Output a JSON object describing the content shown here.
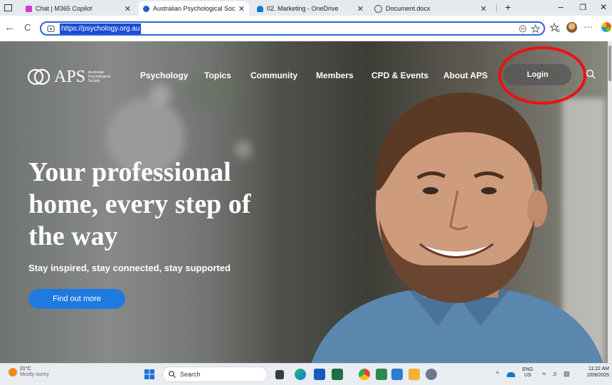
{
  "browser": {
    "tabs": [
      {
        "label": "Chat | M365 Copilot",
        "fav_color": "#c83cc8",
        "active": false
      },
      {
        "label": "Australian Psychological Society |",
        "fav_color": "#2060c0",
        "active": true
      },
      {
        "label": "02. Marketing - OneDrive",
        "fav_color": "#1078d4",
        "active": false
      },
      {
        "label": "Document.docx",
        "fav_color": "#555555",
        "active": false
      }
    ],
    "new_tab_label": "+",
    "minimize_label": "–",
    "restore_label": "❐",
    "close_label": "✕",
    "url": "https://psychology.org.au",
    "back_label": "←",
    "refresh_label": "C",
    "more_label": "···"
  },
  "site": {
    "logo_abbr": "APS",
    "logo_full": "Australian Psychological Society",
    "nav": [
      "Psychology",
      "Topics",
      "Community",
      "Members",
      "CPD & Events",
      "About APS"
    ],
    "login_label": "Login",
    "headline": "Your professional home, every step of the way",
    "subheadline": "Stay inspired, stay connected, stay supported",
    "cta_label": "Find out more",
    "accent": "#1f7ae0",
    "highlight_ring": "#e11111"
  },
  "taskbar": {
    "weather_temp": "21°C",
    "weather_desc": "Mostly sunny",
    "search_placeholder": "Search",
    "lang_top": "ENG",
    "lang_bottom": "US",
    "time": "11:22 AM",
    "date": "2/09/2025"
  }
}
